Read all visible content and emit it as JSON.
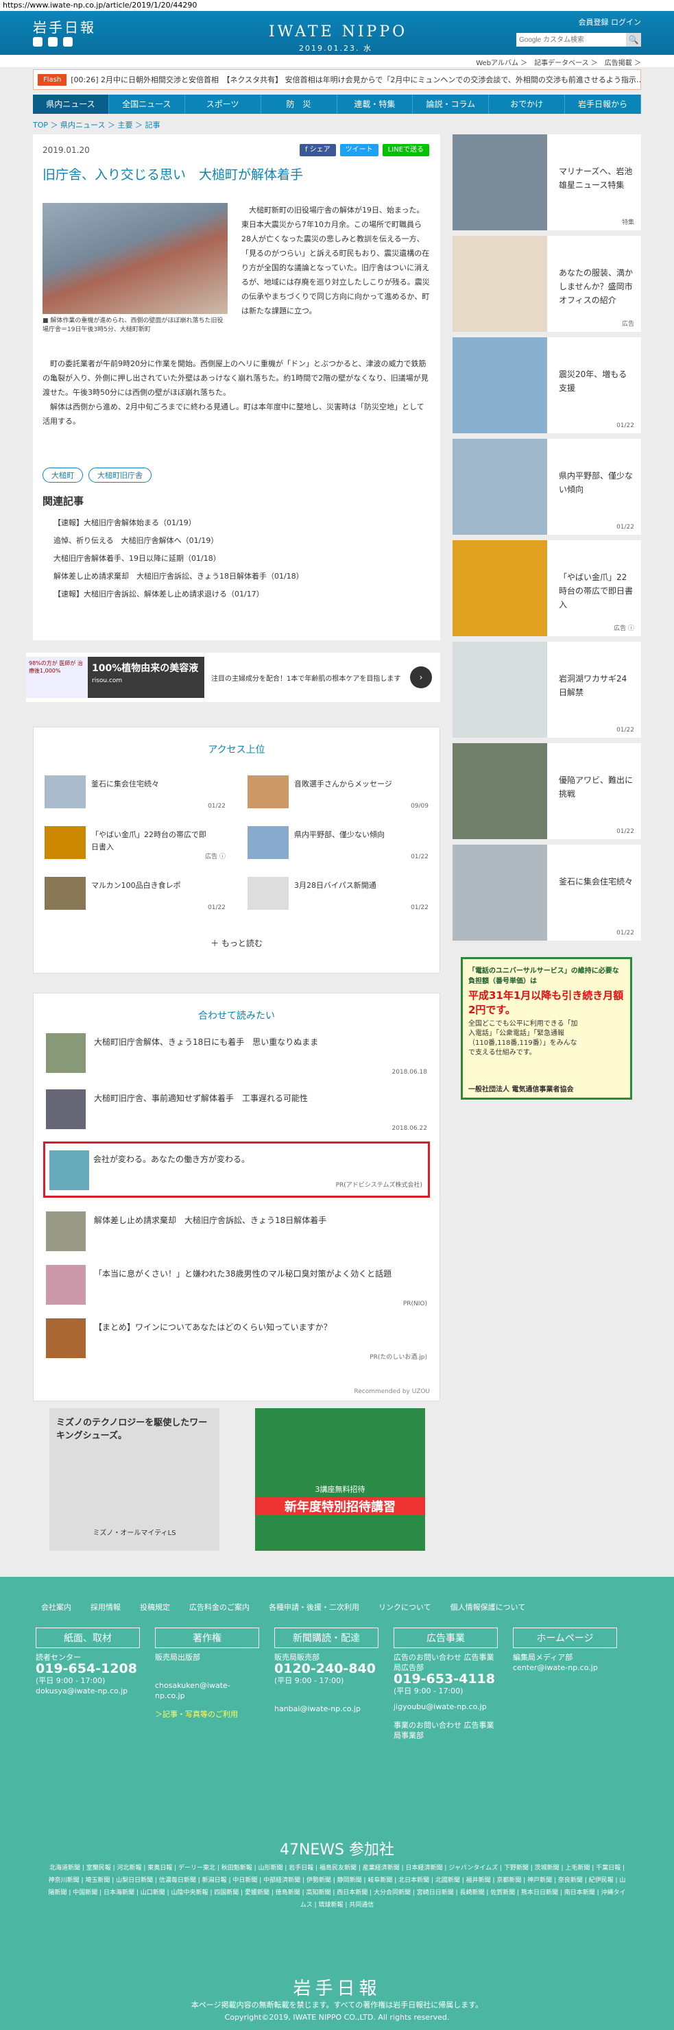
{
  "browser": {
    "url": "https://www.iwate-np.co.jp/article/2019/1/20/44290"
  },
  "header": {
    "logo": "岩手日報",
    "brand": "IWATE NIPPO",
    "date": "2019.01.23. 水",
    "account": "会員登録 ログイン",
    "search_placeholder": "Google カスタム検索",
    "search_btn": "🔍"
  },
  "subbar": "Webアルバム ＞　記事データベース ＞　広告掲載 ＞",
  "flash": {
    "tag": "Flash",
    "text": "[00:26] 2月中に日朝外相間交渉と安倍首相　【ネクスタ共有】 安倍首相は年明け会見からで「2月中にミュンヘンでの交渉会談で、外相間の交渉も前進させるよう指示…"
  },
  "nav": [
    "県内ニュース",
    "全国ニュース",
    "スポーツ",
    "防　災",
    "連載・特集",
    "論説・コラム",
    "おでかけ",
    "岩手日報から"
  ],
  "breadcrumb": "TOP ＞ 県内ニュース ＞ 主要 ＞ 記事",
  "article": {
    "date": "2019.01.20",
    "share": [
      "f シェア",
      "ツイート",
      "LINEで送る"
    ],
    "title": "旧庁舎、入り交じる思い　大槌町が解体着手",
    "caption": "■ 解体作業の重機が進められ、西側の壁面がほぼ崩れ落ちた旧役場庁舎＝19日午後3時5分、大槌町新町",
    "body1": "　大槌町新町の旧役場庁舎の解体が19日、始まった。東日本大震災から7年10カ月余。この場所で町職員ら28人が亡くなった震災の悲しみと教訓を伝える一方、「見るのがつらい」と訴える町民もおり、震災遺構の在り方が全国的な議論となっていた。旧庁舎はついに消えるが、地域には存廃を巡り対立したしこりが残る。震災の伝承やまちづくりで同じ方向に向かって進めるか、町は新たな課題に立つ。",
    "body2": "　町の委託業者が午前9時20分に作業を開始。西側屋上のヘリに重機が「ドン」とぶつかると、津波の威力で鉄筋の亀裂が入り、外側に押し出されていた外壁はあっけなく崩れ落ちた。約1時間で2階の壁がなくなり、旧議場が見渡せた。午後3時50分には西側の壁がほぼ崩れ落ちた。\n　解体は西側から進め、2月中旬ごろまでに終わる見通し。町は本年度中に整地し、災害時は「防災空地」として活用する。",
    "tags": [
      "大槌町",
      "大槌町旧庁舎"
    ],
    "related_heading": "関連記事",
    "related": [
      "【速報】大槌旧庁舎解体始まる（01/19）",
      "追悼、祈り伝える　大槌旧庁舎解体へ（01/19）",
      "大槌旧庁舎解体着手、19日以降に延期（01/18）",
      "解体差し止め請求棄却　大槌旧庁舎訴訟、きょう18日解体着手（01/18）",
      "【速報】大槌旧庁舎訴訟、解体差し止め請求退ける（01/17）"
    ]
  },
  "ad_banner": {
    "a": "98%の方が 医師が 治療後1,000%",
    "b": "100%植物由来の美容液",
    "b_sub": "risou.com",
    "c": "注目の主婦成分を配合！1本で年齢肌の根本ケアを目指します",
    "arrow": "›"
  },
  "access": {
    "heading": "アクセス上位",
    "items": [
      {
        "text": "釜石に集会住宅続々",
        "date": "01/22"
      },
      {
        "text": "音敗選手さんからメッセージ",
        "date": "09/09"
      },
      {
        "text": "「やばい金爪」22時台の帯広で即日書入",
        "date": "広告 ⓘ"
      },
      {
        "text": "県内平野部、僅少ない傾向",
        "date": "01/22"
      },
      {
        "text": "マルカン100品白き食レポ",
        "date": "01/22"
      },
      {
        "text": "3月28日バイパス新開通",
        "date": "01/22"
      }
    ],
    "more": "＋ もっと読む"
  },
  "readtogether": {
    "heading": "合わせて読みたい",
    "items": [
      {
        "text": "大槌町旧庁舎解体、きょう18日にも着手　思い重なりぬまま",
        "date": "2018.06.18"
      },
      {
        "text": "大槌町旧庁舎、事前適知せず解体着手　工事遅れる可能性",
        "date": "2018.06.22"
      },
      {
        "text": "会社が変わる。あなたの働き方が変わる。",
        "date": "PR(アドビシステムズ株式会社)"
      },
      {
        "text": "解体差し止め請求棄却　大槌旧庁舎訴訟、きょう18日解体着手",
        "date": ""
      },
      {
        "text": "「本当に息がくさい！」と嫌われた38歳男性のマル秘口臭対策がよく効くと話題",
        "date": "PR(NIO)"
      },
      {
        "text": "【まとめ】ワインについてあなたはどのくらい知っていますか？",
        "date": "PR(たのしいお酒.jp)"
      }
    ],
    "recommended": "Recommended by UZOU"
  },
  "ads_bottom": {
    "left": "ミズノのテクノロジーを駆使したワーキングシューズ。",
    "left_sub": "ミズノ・オールマイティLS",
    "right": "新年度特別招待講習",
    "right_sub": "3講座無料招待"
  },
  "sidebar": [
    {
      "text": "マリナーズへ、岩池雄星ニュース特集",
      "date": "特集"
    },
    {
      "text": "あなたの服装、満かしませんか？盛岡市オフィスの紹介",
      "date": "広告"
    },
    {
      "text": "震災20年、増もる支援",
      "date": "01/22"
    },
    {
      "text": "県内平野部、僅少ない傾向",
      "date": "01/22"
    },
    {
      "text": "「やばい金爪」22時台の帯広で即日書入",
      "date": "広告 ⓘ"
    },
    {
      "text": "岩洞湖ワカサギ24日解禁",
      "date": "01/22"
    },
    {
      "text": "優陥アワビ、難出に挑戦",
      "date": "01/22"
    },
    {
      "text": "釜石に集会住宅続々",
      "date": "01/22"
    }
  ],
  "side_ad": {
    "title": "「電話のユニバーサルサービス」の維持に必要な負担額（番号単価）は",
    "big": "平成31年1月以降も引き続き月額2円です。",
    "body": "全国どこでも公平に利用できる「加入電話」「公衆電話」「緊急通報（110番,118番,119番）」をみんなで支える仕組みです。",
    "org": "一般社団法人 電気通信事業者協会"
  },
  "footer": {
    "links": [
      "会社案内",
      "採用情報",
      "投稿規定",
      "広告料金のご案内",
      "各種申請・後援・二次利用",
      "リンクについて",
      "個人情報保護について"
    ],
    "cols": [
      {
        "head": "紙面、取材",
        "l1": "読者センター",
        "phone": "019-654-1208",
        "hours": "(平日 9:00 - 17:00)",
        "mail": "dokusya@iwate-np.co.jp",
        "extra": ""
      },
      {
        "head": "著作権",
        "l1": "販売局出版部",
        "phone": "",
        "hours": "",
        "mail": "chosakuken@iwate-np.co.jp",
        "extra": "＞記事・写真等のご利用"
      },
      {
        "head": "新聞購読・配達",
        "l1": "販売局販売部",
        "phone": "0120-240-840",
        "hours": "(平日 9:00 - 17:00)",
        "mail": "hanbai@iwate-np.co.jp",
        "extra": ""
      },
      {
        "head": "広告事業",
        "l1": "広告のお問い合わせ 広告事業局広告部",
        "phone": "019-653-4118",
        "hours": "(平日 9:00 - 17:00)",
        "mail": "jigyoubu@iwate-np.co.jp",
        "extra": "事業のお問い合わせ 広告事業局事業部"
      },
      {
        "head": "ホームページ",
        "l1": "編集局メディア部",
        "phone": "",
        "hours": "",
        "mail": "center@iwate-np.co.jp",
        "extra": ""
      }
    ],
    "n47": "47NEWS 参加社",
    "n47list": "北海道新聞 | 室蘭民報 | 河北新報 | 東奥日報 | デーリー東北 | 秋田魁新報 | 山形新聞 | 岩手日報 | 福島民友新聞 | 産業経済新聞 | 日本経済新聞 | ジャパンタイムズ | 下野新聞 | 茨城新聞 | 上毛新聞 | 千葉日報 | 神奈川新聞 | 埼玉新聞 | 山梨日日新聞 | 信濃毎日新聞 | 新潟日報 | 中日新聞 | 中部経済新聞 | 伊勢新聞 | 静岡新聞 | 岐阜新聞 | 北日本新聞 | 北國新聞 | 福井新聞 | 京都新聞 | 神戸新聞 | 奈良新聞 | 紀伊民報 | 山陽新聞 | 中国新聞 | 日本海新聞 | 山口新聞 | 山陰中央新報 | 四国新聞 | 愛媛新聞 | 徳島新聞 | 高知新聞 | 西日本新聞 | 大分合同新聞 | 宮崎日日新聞 | 長崎新聞 | 佐賀新聞 | 熊本日日新聞 | 南日本新聞 | 沖縄タイムス | 琉球新報 | 共同通信",
    "logo": "岩手日報",
    "note": "本ページ掲載内容の無断転載を禁じます。すべての著作権は岩手日報社に帰属します。",
    "copy": "Copyright©2019, IWATE NIPPO CO.,LTD. All rights reserved."
  }
}
